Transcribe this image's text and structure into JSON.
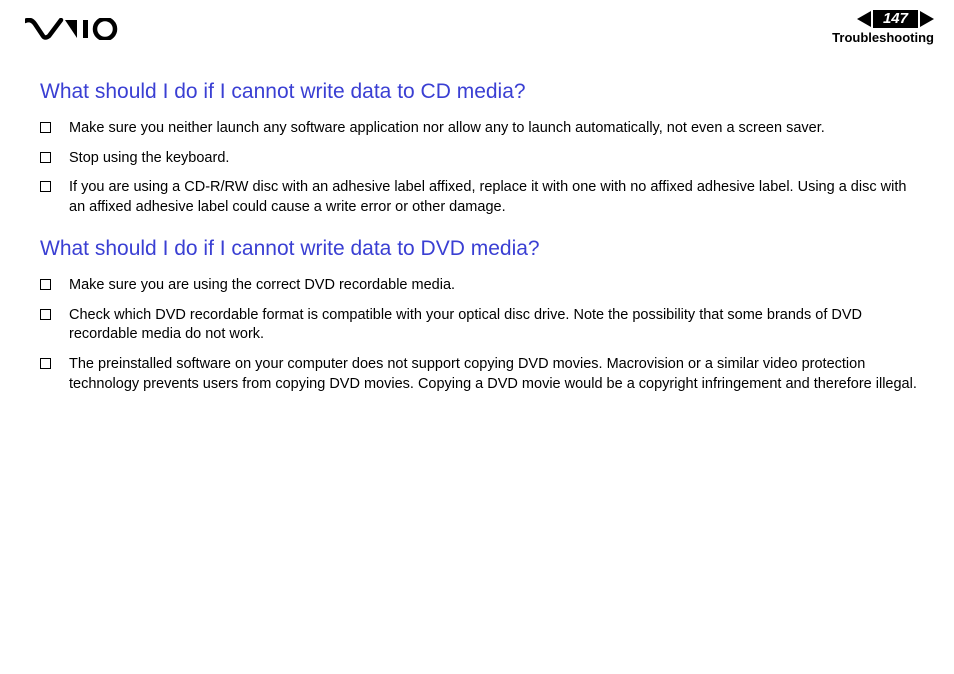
{
  "header": {
    "page_number": "147",
    "section": "Troubleshooting"
  },
  "content": {
    "heading1": "What should I do if I cannot write data to CD media?",
    "list1": [
      "Make sure you neither launch any software application nor allow any to launch automatically, not even a screen saver.",
      "Stop using the keyboard.",
      "If you are using a CD-R/RW disc with an adhesive label affixed, replace it with one with no affixed adhesive label. Using a disc with an affixed adhesive label could cause a write error or other damage."
    ],
    "heading2": "What should I do if I cannot write data to DVD media?",
    "list2": [
      "Make sure you are using the correct DVD recordable media.",
      "Check which DVD recordable format is compatible with your optical disc drive. Note the possibility that some brands of DVD recordable media do not work.",
      "The preinstalled software on your computer does not support copying DVD movies. Macrovision or a similar video protection technology prevents users from copying DVD movies. Copying a DVD movie would be a copyright infringement and therefore illegal."
    ]
  }
}
